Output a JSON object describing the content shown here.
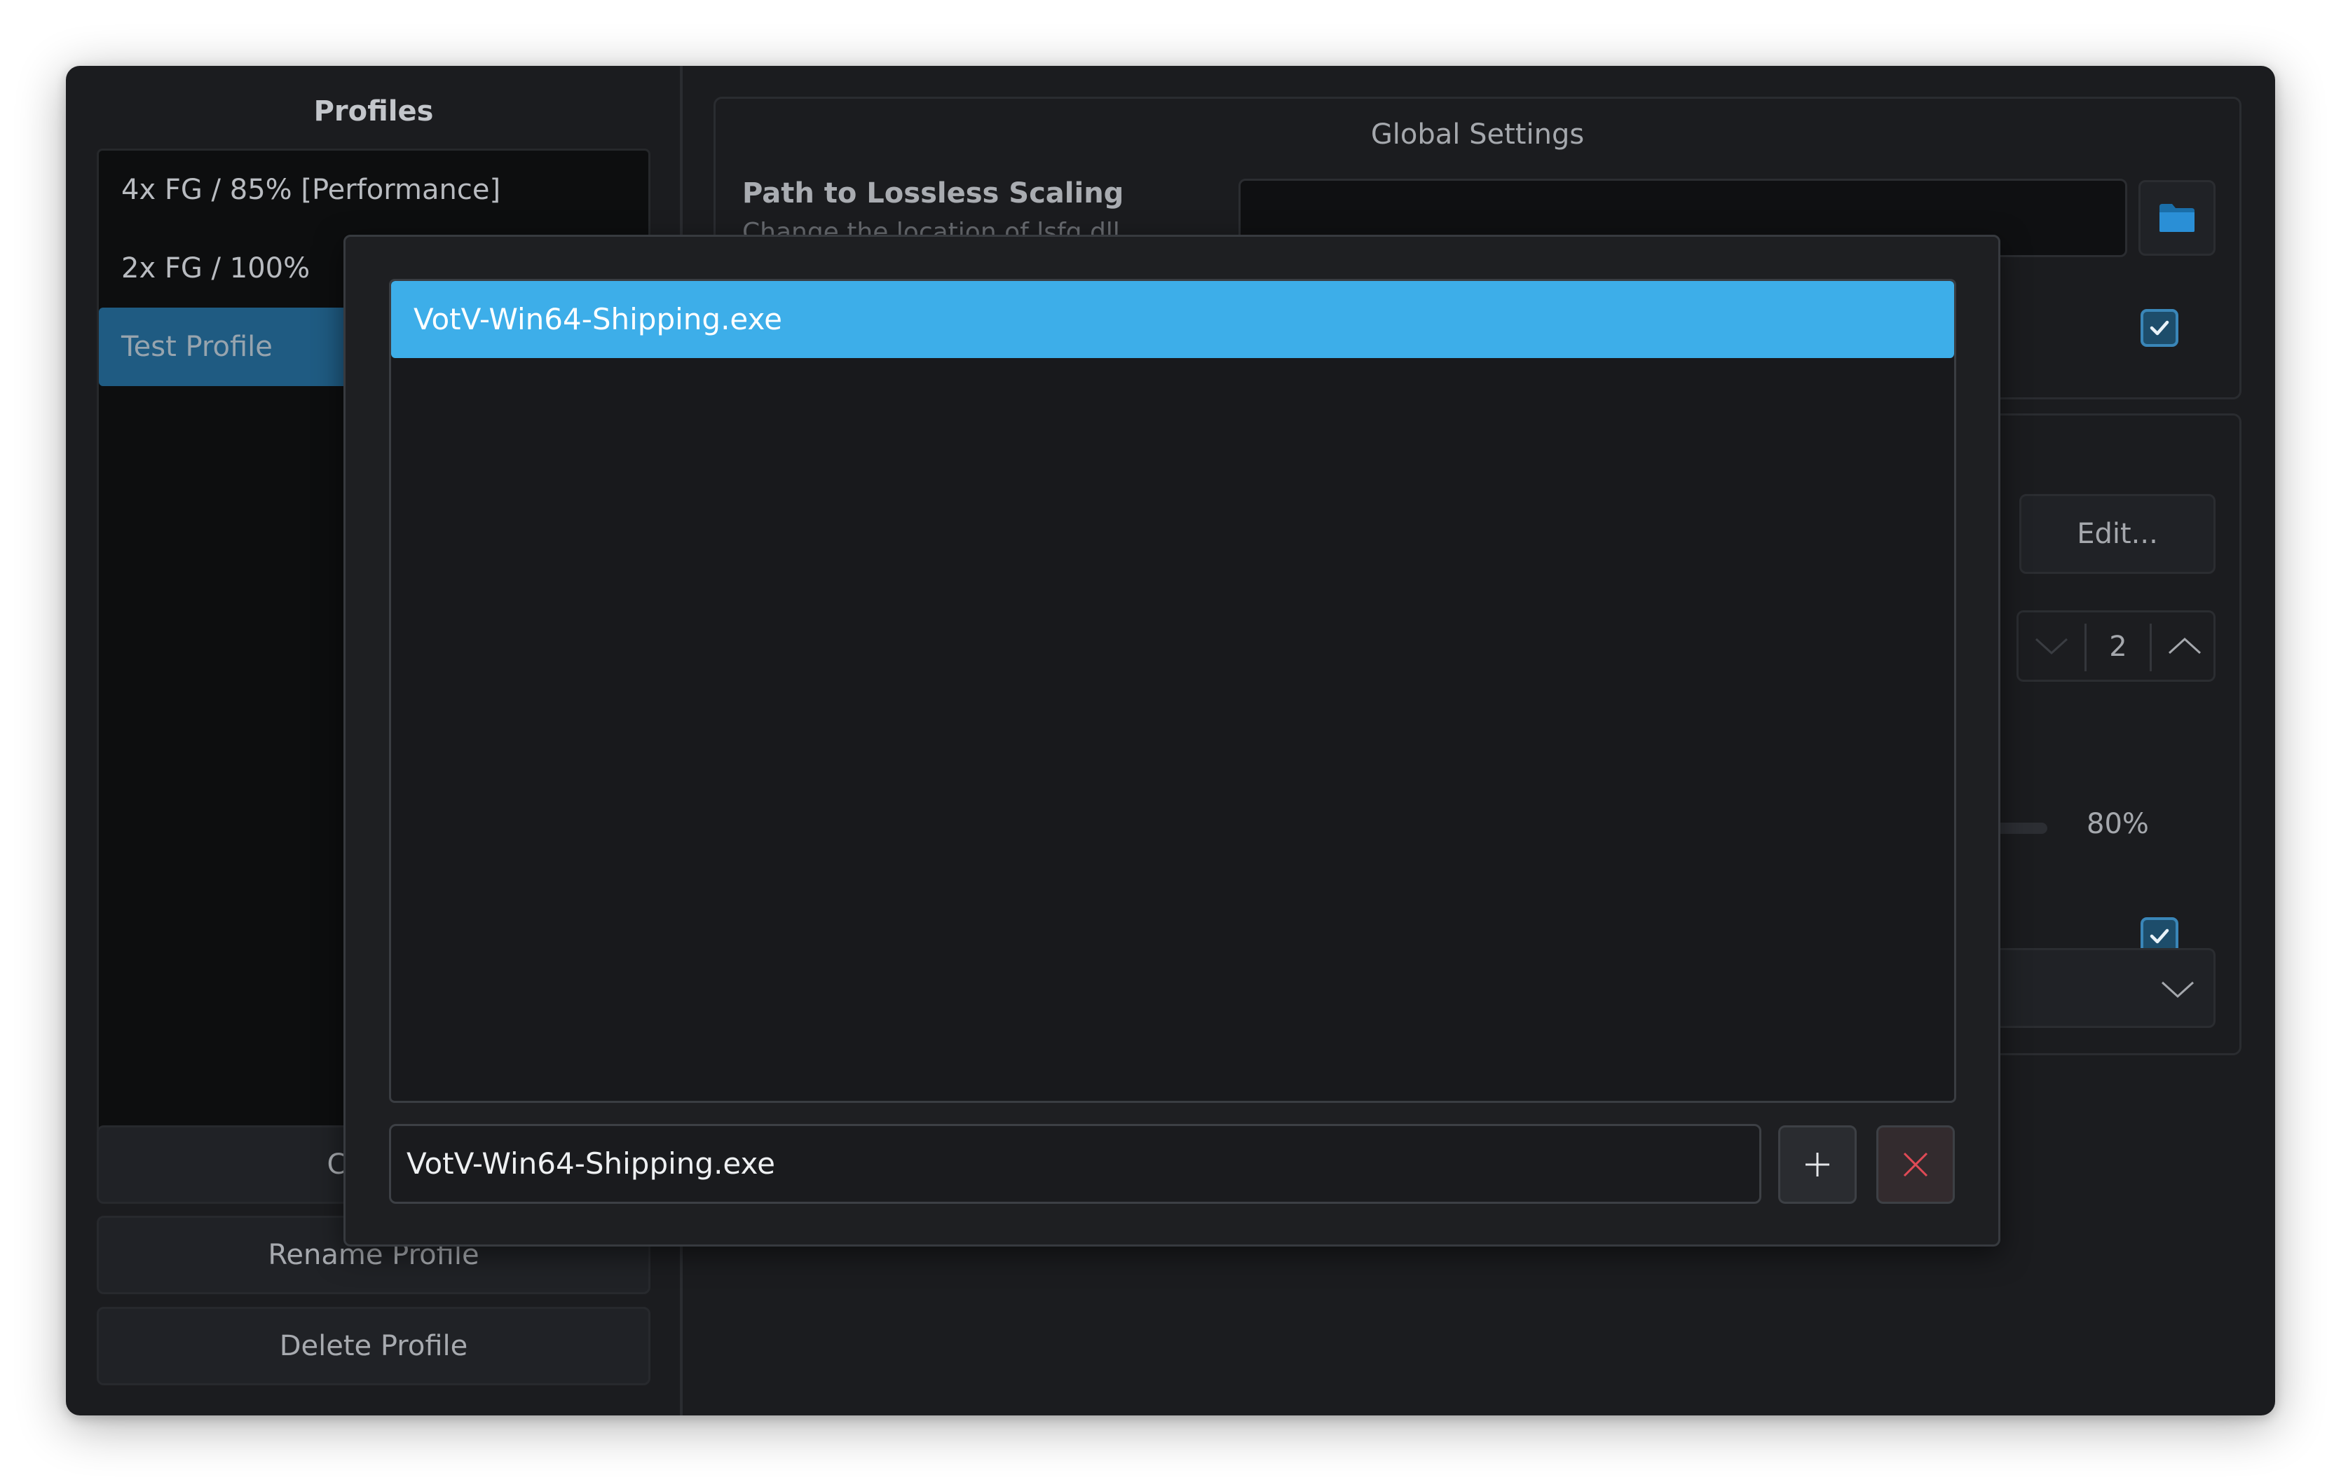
{
  "profiles": {
    "title": "Profiles",
    "items": [
      {
        "label": "4x FG / 85% [Performance]"
      },
      {
        "label": "2x FG / 100%"
      },
      {
        "label": "Test Profile"
      }
    ],
    "create_label": "Create",
    "rename_label": "Rename Profile",
    "delete_label": "Delete Profile"
  },
  "global_settings": {
    "title": "Global Settings",
    "path_label": "Path to Lossless Scaling",
    "path_desc": "Change the location of lsfg.dll",
    "path_value": "",
    "checkbox_checked": true
  },
  "profile_settings": {
    "edit_label": "Edit...",
    "multiplier_value": "2",
    "flow_scale_value": "80%",
    "flow_scale_fraction": 0.8,
    "checkbox_checked": true
  },
  "dialog": {
    "list_items": [
      {
        "label": "VotV-Win64-Shipping.exe",
        "selected": true
      }
    ],
    "input_value": "VotV-Win64-Shipping.exe",
    "add_icon": "plus-icon",
    "remove_icon": "close-icon"
  },
  "colors": {
    "accent": "#3daee9",
    "selection_dim": "#1f5b82",
    "remove": "#e04a56"
  }
}
